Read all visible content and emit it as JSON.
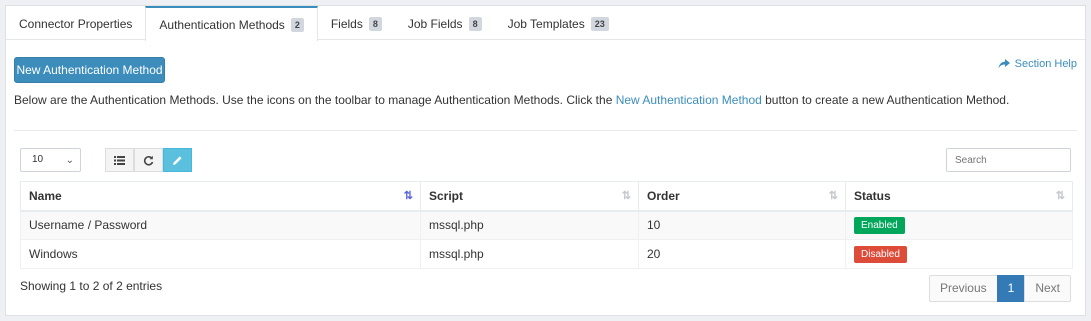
{
  "tabs": [
    {
      "label": "Connector Properties",
      "badge": null
    },
    {
      "label": "Authentication Methods",
      "badge": "2"
    },
    {
      "label": "Fields",
      "badge": "8"
    },
    {
      "label": "Job Fields",
      "badge": "8"
    },
    {
      "label": "Job Templates",
      "badge": "23"
    }
  ],
  "active_tab": "Authentication Methods",
  "new_button_label": "New Authentication Method",
  "section_help_label": "Section Help",
  "intro": {
    "before": "Below are the Authentication Methods. Use the icons on the toolbar to manage Authentication Methods. Click the ",
    "link": "New Authentication Method",
    "after": " button to create a new Authentication Method."
  },
  "page_size": {
    "selected": "10"
  },
  "toolbar": {
    "icons": [
      "list-icon",
      "refresh-icon",
      "pencil-icon"
    ]
  },
  "search": {
    "placeholder": "Search"
  },
  "table": {
    "columns": [
      "Name",
      "Script",
      "Order",
      "Status"
    ],
    "rows": [
      {
        "name": "Username / Password",
        "script": "mssql.php",
        "order": "10",
        "status": "Enabled"
      },
      {
        "name": "Windows",
        "script": "mssql.php",
        "order": "20",
        "status": "Disabled"
      }
    ]
  },
  "info_text": "Showing 1 to 2 of 2 entries",
  "pagination": {
    "previous": "Previous",
    "current": "1",
    "next": "Next"
  },
  "colors": {
    "primary": "#3c8dbc",
    "enabled": "#00a65a",
    "disabled": "#dd4b39",
    "edit_active": "#5bc0de"
  }
}
